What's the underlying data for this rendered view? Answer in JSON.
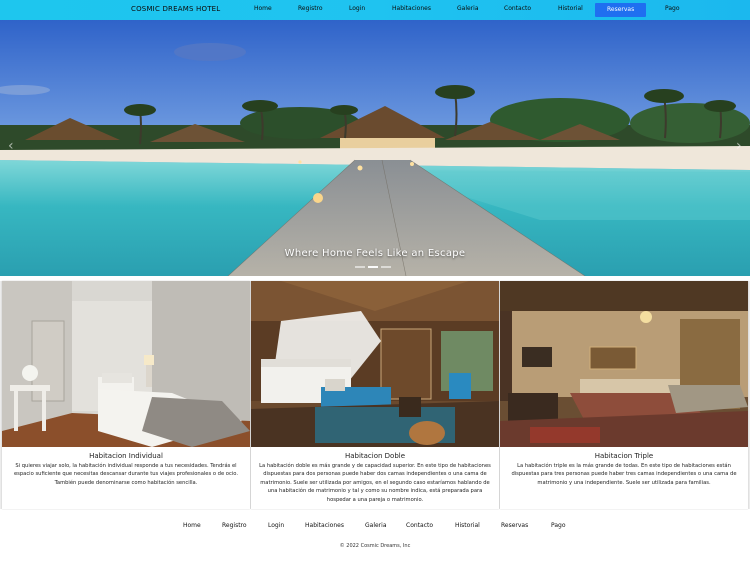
{
  "nav": {
    "brand": "COSMIC DREAMS HOTEL",
    "items": [
      "Home",
      "Registro",
      "Login",
      "Habitaciones",
      "Galeria",
      "Contacto",
      "Historial",
      "Reservas",
      "Pago"
    ],
    "active": "Reservas"
  },
  "hero": {
    "caption": "Where Home Feels Like an Escape",
    "slides": 3,
    "active_slide": 1
  },
  "rooms": [
    {
      "title": "Habitacion Individual",
      "description": "Si quieres viajar solo, la habitación individual responde a tus necesidades. Tendrás el espacio suficiente que necesitas descansar durante tus viajes profesionales o de ocio. También puede denominarse como habitación sencilla."
    },
    {
      "title": "Habitacion Doble",
      "description": "La habitación doble es más grande y de capacidad superior. En este tipo de habitaciones dispuestas para dos personas puede haber dos camas independientes o una cama de matrimonio. Suele ser utilizada por amigos, en el segundo caso estaríamos hablando de una habitación de matrimonio y tal y como su nombre indica, está preparada para hospedar a una pareja o matrimonio."
    },
    {
      "title": "Habitacion Triple",
      "description": "La habitación triple es la más grande de todas. En este tipo de habitaciones están dispuestas para tres personas puede haber tres camas independientes o una cama de matrimonio y una independiente. Suele ser utilizada para familias."
    }
  ],
  "footer": {
    "items": [
      "Home",
      "Registro",
      "Login",
      "Habitaciones",
      "Galeria",
      "Contacto",
      "Historial",
      "Reservas",
      "Pago"
    ],
    "copyright": "© 2022 Cosmic Dreams, Inc"
  },
  "colors": {
    "nav_bg": "#1ec6ee",
    "active_bg": "#1f6ff0",
    "active_text": "#ffffff"
  }
}
